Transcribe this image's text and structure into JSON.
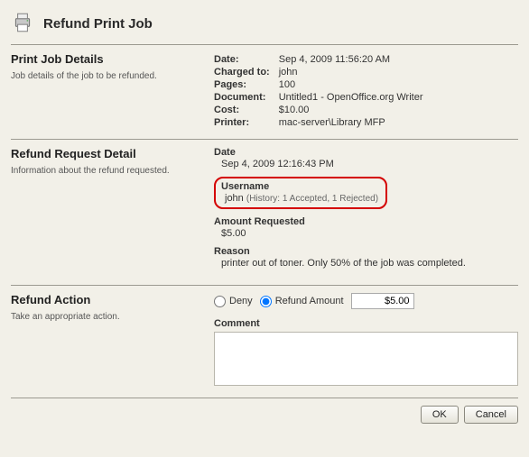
{
  "title": "Refund Print Job",
  "sections": {
    "details": {
      "heading": "Print Job Details",
      "desc": "Job details of the job to be refunded.",
      "rows": {
        "date_k": "Date:",
        "date_v": "Sep 4, 2009 11:56:20 AM",
        "charged_k": "Charged to:",
        "charged_v": "john",
        "pages_k": "Pages:",
        "pages_v": "100",
        "doc_k": "Document:",
        "doc_v": "Untitled1 - OpenOffice.org Writer",
        "cost_k": "Cost:",
        "cost_v": "$10.00",
        "printer_k": "Printer:",
        "printer_v": "mac-server\\Library MFP"
      }
    },
    "request": {
      "heading": "Refund Request Detail",
      "desc": "Information about the refund requested.",
      "date_l": "Date",
      "date_v": "Sep 4, 2009 12:16:43 PM",
      "user_l": "Username",
      "user_v": "john",
      "user_hist": "(History: 1 Accepted, 1 Rejected)",
      "amount_l": "Amount Requested",
      "amount_v": "$5.00",
      "reason_l": "Reason",
      "reason_v": "printer out of toner. Only 50% of the job was completed."
    },
    "action": {
      "heading": "Refund Action",
      "desc": "Take an appropriate action.",
      "deny_l": "Deny",
      "refund_l": "Refund Amount",
      "amount_input": "$5.00",
      "comment_l": "Comment"
    }
  },
  "buttons": {
    "ok": "OK",
    "cancel": "Cancel"
  }
}
